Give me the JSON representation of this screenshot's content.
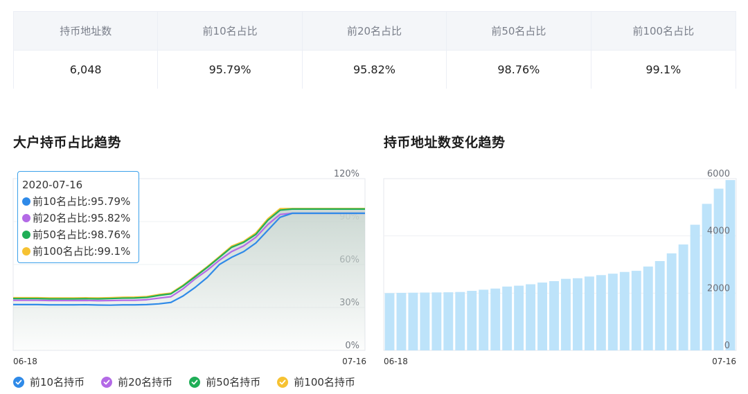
{
  "summary": {
    "headers": [
      "持币地址数",
      "前10名占比",
      "前20名占比",
      "前50名占比",
      "前100名占比"
    ],
    "values": [
      "6,048",
      "95.79%",
      "95.82%",
      "98.76%",
      "99.1%"
    ]
  },
  "left_title": "大户持币占比趋势",
  "right_title": "持币地址数变化趋势",
  "tooltip": {
    "date": "2020-07-16",
    "rows": [
      "前10名占比:95.79%",
      "前20名占比:95.82%",
      "前50名占比:98.76%",
      "前100名占比:99.1%"
    ]
  },
  "legend": [
    "前10名持币",
    "前20名持币",
    "前50名持币",
    "前100名持币"
  ],
  "colors": {
    "top10": "#2f8ae8",
    "top20": "#b36ae6",
    "top50": "#1fae57",
    "top100": "#f6c232",
    "bars": "#bde3fa",
    "area": "#c9d6d0"
  },
  "chart_data": [
    {
      "type": "line",
      "title": "大户持币占比趋势",
      "x_start_label": "06-18",
      "x_end_label": "07-16",
      "y_ticks": [
        "0%",
        "30%",
        "60%",
        "90%",
        "120%"
      ],
      "ylim": [
        0,
        120
      ],
      "series": [
        {
          "name": "前10名持币",
          "values": [
            32,
            32,
            32,
            31.8,
            31.8,
            31.8,
            31.9,
            31.7,
            31.6,
            31.8,
            31.8,
            32,
            32.5,
            33.5,
            38,
            44,
            51,
            60,
            65,
            69,
            75,
            84,
            93,
            95.79,
            95.79,
            95.79,
            95.79,
            95.79,
            95.79,
            95.79
          ]
        },
        {
          "name": "前20名持币",
          "values": [
            35,
            35,
            35,
            34.8,
            34.8,
            34.8,
            34.9,
            34.7,
            34.8,
            35,
            35,
            35.4,
            36.5,
            37.5,
            43,
            50,
            56,
            63,
            69,
            73,
            79,
            88,
            95,
            95.82,
            95.82,
            95.82,
            95.82,
            95.82,
            95.82,
            95.82
          ]
        },
        {
          "name": "前50名持币",
          "values": [
            36.2,
            36.2,
            36.2,
            36.0,
            36.0,
            36.0,
            36.1,
            36.0,
            36.2,
            36.5,
            36.6,
            37,
            38.4,
            39.5,
            45,
            51.5,
            58,
            65,
            72,
            75.5,
            81,
            91,
            98,
            98.76,
            98.76,
            98.76,
            98.76,
            98.76,
            98.76,
            98.76
          ]
        },
        {
          "name": "前100名持币",
          "values": [
            36.8,
            36.8,
            36.8,
            36.6,
            36.6,
            36.6,
            36.7,
            36.6,
            36.8,
            37.1,
            37.2,
            37.6,
            39,
            40,
            45.5,
            52,
            58.5,
            65.5,
            72.8,
            76.2,
            82,
            92,
            99,
            99.1,
            99.1,
            99.1,
            99.1,
            99.1,
            99.1,
            99.1
          ]
        }
      ]
    },
    {
      "type": "bar",
      "title": "持币地址数变化趋势",
      "x_start_label": "06-18",
      "x_end_label": "07-16",
      "y_ticks": [
        "0",
        "2000",
        "4000",
        "6000"
      ],
      "ylim": [
        0,
        6000
      ],
      "values": [
        2000,
        2010,
        2015,
        2020,
        2025,
        2030,
        2040,
        2080,
        2120,
        2160,
        2230,
        2260,
        2310,
        2370,
        2420,
        2500,
        2520,
        2580,
        2630,
        2680,
        2740,
        2780,
        2930,
        3120,
        3390,
        3700,
        4390,
        5120,
        5650,
        5950
      ]
    }
  ]
}
